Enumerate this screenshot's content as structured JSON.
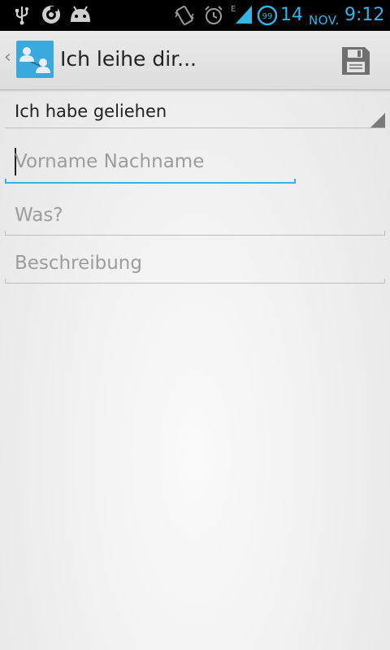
{
  "status_bar": {
    "date": "14",
    "month": "NOV.",
    "time": "9:12",
    "network_label": "E",
    "notification_count": "99",
    "accent_color": "#33b5e5",
    "icons": [
      "usb-icon",
      "camera-notification-icon",
      "android-icon",
      "vibrate-icon",
      "alarm-icon",
      "signal-icon",
      "notification-badge-icon"
    ]
  },
  "action_bar": {
    "title": "Ich leihe dir...",
    "icons": [
      "up-caret-icon",
      "app-icon",
      "save-icon"
    ]
  },
  "form": {
    "spinner_value": "Ich habe geliehen",
    "name_placeholder": "Vorname Nachname",
    "what_placeholder": "Was?",
    "description_placeholder": "Beschreibung"
  }
}
